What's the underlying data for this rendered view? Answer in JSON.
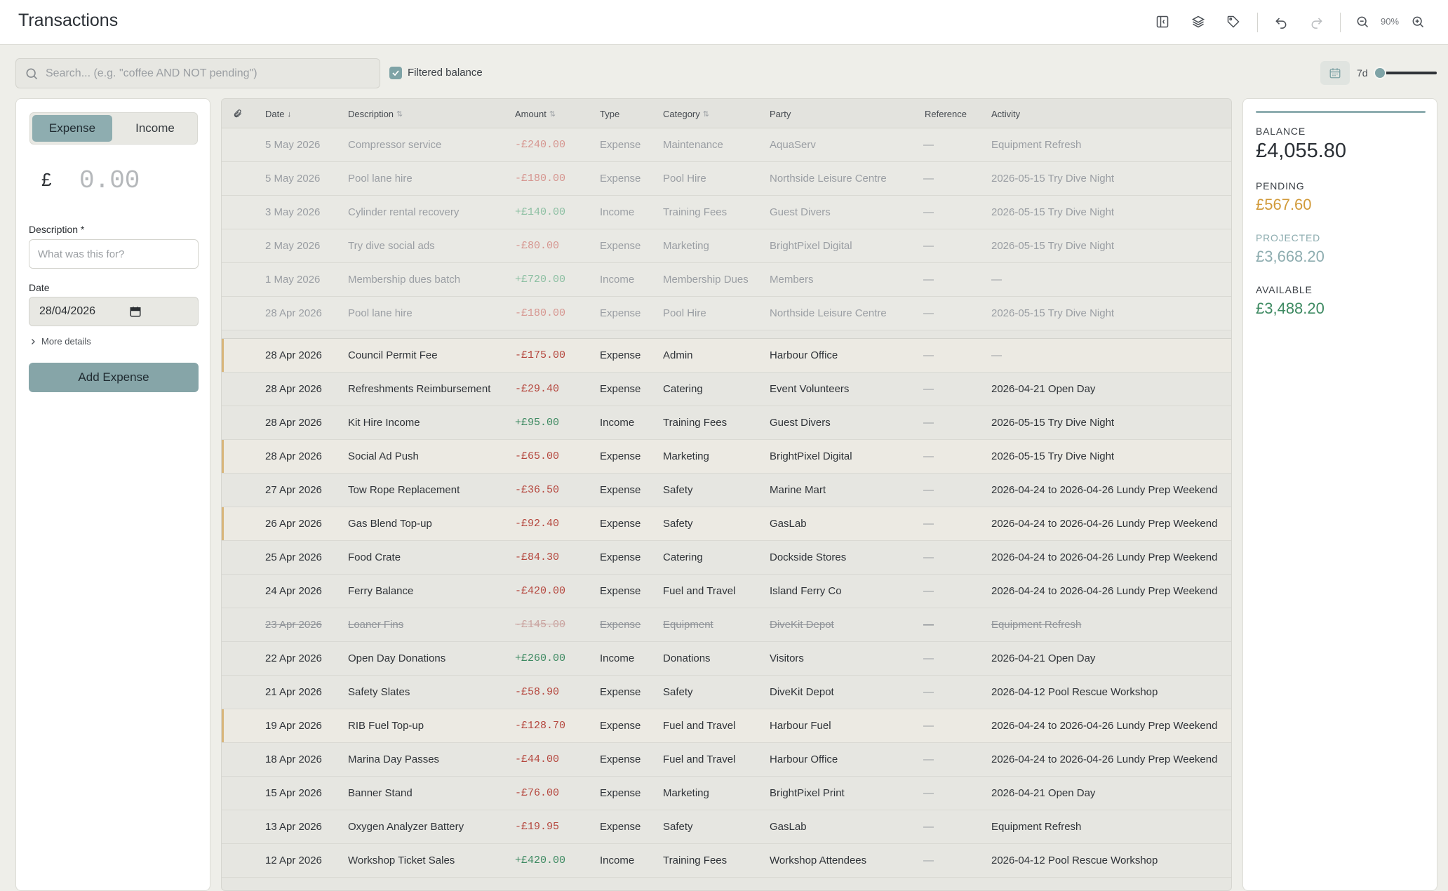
{
  "header": {
    "title": "Transactions",
    "zoom": "90%"
  },
  "toolbar": {
    "search_placeholder": "Search... (e.g. \"coffee AND NOT pending\")",
    "filtered_balance_label": "Filtered balance",
    "filtered_balance_checked": true,
    "range_label": "7d"
  },
  "entry": {
    "type_expense": "Expense",
    "type_income": "Income",
    "currency_symbol": "£",
    "amount_placeholder": "0.00",
    "description_label": "Description *",
    "description_placeholder": "What was this for?",
    "date_label": "Date",
    "date_value": "28/04/2026",
    "more_details": "More details",
    "submit_label": "Add Expense"
  },
  "table": {
    "columns": [
      "Date",
      "Description",
      "Amount",
      "Type",
      "Category",
      "Party",
      "Reference",
      "Activity"
    ],
    "upcoming": [
      {
        "date": "5 May 2026",
        "description": "Compressor service",
        "amount": "-£240.00",
        "type": "Expense",
        "category": "Maintenance",
        "party": "AquaServ",
        "reference": "—",
        "activity": "Equipment Refresh"
      },
      {
        "date": "5 May 2026",
        "description": "Pool lane hire",
        "amount": "-£180.00",
        "type": "Expense",
        "category": "Pool Hire",
        "party": "Northside Leisure Centre",
        "reference": "—",
        "activity": "2026-05-15 Try Dive Night"
      },
      {
        "date": "3 May 2026",
        "description": "Cylinder rental recovery",
        "amount": "+£140.00",
        "type": "Income",
        "category": "Training Fees",
        "party": "Guest Divers",
        "reference": "—",
        "activity": "2026-05-15 Try Dive Night"
      },
      {
        "date": "2 May 2026",
        "description": "Try dive social ads",
        "amount": "-£80.00",
        "type": "Expense",
        "category": "Marketing",
        "party": "BrightPixel Digital",
        "reference": "—",
        "activity": "2026-05-15 Try Dive Night"
      },
      {
        "date": "1 May 2026",
        "description": "Membership dues batch",
        "amount": "+£720.00",
        "type": "Income",
        "category": "Membership Dues",
        "party": "Members",
        "reference": "—",
        "activity": "—"
      },
      {
        "date": "28 Apr 2026",
        "description": "Pool lane hire",
        "amount": "-£180.00",
        "type": "Expense",
        "category": "Pool Hire",
        "party": "Northside Leisure Centre",
        "reference": "—",
        "activity": "2026-05-15 Try Dive Night"
      }
    ],
    "rows": [
      {
        "date": "28 Apr 2026",
        "description": "Council Permit Fee",
        "amount": "-£175.00",
        "type": "Expense",
        "category": "Admin",
        "party": "Harbour Office",
        "reference": "—",
        "activity": "—",
        "pending": true
      },
      {
        "date": "28 Apr 2026",
        "description": "Refreshments Reimbursement",
        "amount": "-£29.40",
        "type": "Expense",
        "category": "Catering",
        "party": "Event Volunteers",
        "reference": "—",
        "activity": "2026-04-21 Open Day"
      },
      {
        "date": "28 Apr 2026",
        "description": "Kit Hire Income",
        "amount": "+£95.00",
        "type": "Income",
        "category": "Training Fees",
        "party": "Guest Divers",
        "reference": "—",
        "activity": "2026-05-15 Try Dive Night"
      },
      {
        "date": "28 Apr 2026",
        "description": "Social Ad Push",
        "amount": "-£65.00",
        "type": "Expense",
        "category": "Marketing",
        "party": "BrightPixel Digital",
        "reference": "—",
        "activity": "2026-05-15 Try Dive Night",
        "pending": true
      },
      {
        "date": "27 Apr 2026",
        "description": "Tow Rope Replacement",
        "amount": "-£36.50",
        "type": "Expense",
        "category": "Safety",
        "party": "Marine Mart",
        "reference": "—",
        "activity": "2026-04-24 to 2026-04-26 Lundy Prep Weekend"
      },
      {
        "date": "26 Apr 2026",
        "description": "Gas Blend Top-up",
        "amount": "-£92.40",
        "type": "Expense",
        "category": "Safety",
        "party": "GasLab",
        "reference": "—",
        "activity": "2026-04-24 to 2026-04-26 Lundy Prep Weekend",
        "pending": true
      },
      {
        "date": "25 Apr 2026",
        "description": "Food Crate",
        "amount": "-£84.30",
        "type": "Expense",
        "category": "Catering",
        "party": "Dockside Stores",
        "reference": "—",
        "activity": "2026-04-24 to 2026-04-26 Lundy Prep Weekend"
      },
      {
        "date": "24 Apr 2026",
        "description": "Ferry Balance",
        "amount": "-£420.00",
        "type": "Expense",
        "category": "Fuel and Travel",
        "party": "Island Ferry Co",
        "reference": "—",
        "activity": "2026-04-24 to 2026-04-26 Lundy Prep Weekend"
      },
      {
        "date": "23 Apr 2026",
        "description": "Loaner Fins",
        "amount": "-£145.00",
        "type": "Expense",
        "category": "Equipment",
        "party": "DiveKit Depot",
        "reference": "—",
        "activity": "Equipment Refresh",
        "struck": true
      },
      {
        "date": "22 Apr 2026",
        "description": "Open Day Donations",
        "amount": "+£260.00",
        "type": "Income",
        "category": "Donations",
        "party": "Visitors",
        "reference": "—",
        "activity": "2026-04-21 Open Day"
      },
      {
        "date": "21 Apr 2026",
        "description": "Safety Slates",
        "amount": "-£58.90",
        "type": "Expense",
        "category": "Safety",
        "party": "DiveKit Depot",
        "reference": "—",
        "activity": "2026-04-12 Pool Rescue Workshop"
      },
      {
        "date": "19 Apr 2026",
        "description": "RIB Fuel Top-up",
        "amount": "-£128.70",
        "type": "Expense",
        "category": "Fuel and Travel",
        "party": "Harbour Fuel",
        "reference": "—",
        "activity": "2026-04-24 to 2026-04-26 Lundy Prep Weekend",
        "pending": true
      },
      {
        "date": "18 Apr 2026",
        "description": "Marina Day Passes",
        "amount": "-£44.00",
        "type": "Expense",
        "category": "Fuel and Travel",
        "party": "Harbour Office",
        "reference": "—",
        "activity": "2026-04-24 to 2026-04-26 Lundy Prep Weekend"
      },
      {
        "date": "15 Apr 2026",
        "description": "Banner Stand",
        "amount": "-£76.00",
        "type": "Expense",
        "category": "Marketing",
        "party": "BrightPixel Print",
        "reference": "—",
        "activity": "2026-04-21 Open Day"
      },
      {
        "date": "13 Apr 2026",
        "description": "Oxygen Analyzer Battery",
        "amount": "-£19.95",
        "type": "Expense",
        "category": "Safety",
        "party": "GasLab",
        "reference": "—",
        "activity": "Equipment Refresh"
      },
      {
        "date": "12 Apr 2026",
        "description": "Workshop Ticket Sales",
        "amount": "+£420.00",
        "type": "Income",
        "category": "Training Fees",
        "party": "Workshop Attendees",
        "reference": "—",
        "activity": "2026-04-12 Pool Rescue Workshop"
      }
    ]
  },
  "summary": {
    "balance_label": "BALANCE",
    "balance_value": "£4,055.80",
    "pending_label": "PENDING",
    "pending_value": "£567.60",
    "projected_label": "PROJECTED",
    "projected_value": "£3,668.20",
    "available_label": "AVAILABLE",
    "available_value": "£3,488.20"
  },
  "colors": {
    "accent": "#8eadb0",
    "expense": "#b5473e",
    "income": "#3e8a62",
    "pending": "#d8b57a",
    "pending_text": "#d19a3a",
    "balance_text": "#2a2f35",
    "projected_text": "#8eadb0",
    "available_text": "#3e8a62"
  },
  "icons": [
    "sidebar-toggle-icon",
    "layers-icon",
    "tag-icon",
    "undo-icon",
    "redo-icon",
    "zoom-out-icon",
    "zoom-in-icon",
    "search-icon",
    "calendar-icon",
    "chevron-right-icon",
    "attachment-icon",
    "check-icon"
  ]
}
